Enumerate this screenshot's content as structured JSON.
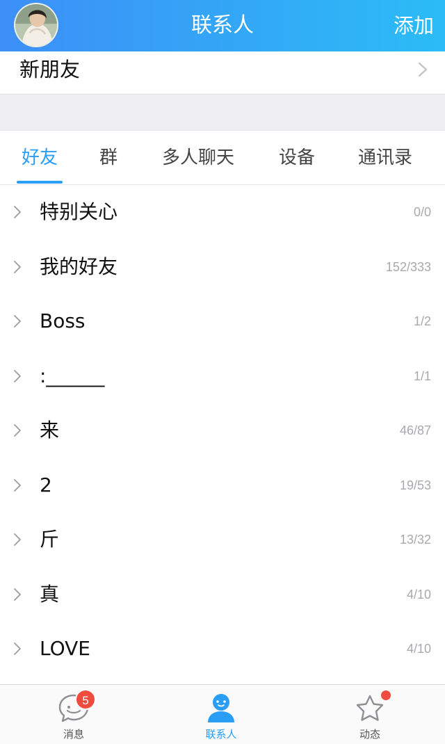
{
  "header": {
    "title": "联系人",
    "action_label": "添加",
    "avatar": "avatar-image",
    "colors": {
      "gradient_start": "#3d8ff7",
      "gradient_end": "#2bbcf6"
    }
  },
  "new_friends": {
    "label": "新朋友",
    "icon": "chevron-right-icon"
  },
  "tabs": [
    {
      "label": "好友",
      "active": true
    },
    {
      "label": "群",
      "active": false
    },
    {
      "label": "多人聊天",
      "active": false
    },
    {
      "label": "设备",
      "active": false
    },
    {
      "label": "通讯录",
      "active": false
    }
  ],
  "groups": [
    {
      "name": "特别关心",
      "count": "0/0"
    },
    {
      "name": "我的好友",
      "count": "152/333"
    },
    {
      "name": "Boss",
      "count": "1/2"
    },
    {
      "name": ":______",
      "count": "1/1"
    },
    {
      "name": "来",
      "count": "46/87"
    },
    {
      "name": "2",
      "count": "19/53"
    },
    {
      "name": "斤",
      "count": "13/32"
    },
    {
      "name": "真",
      "count": "4/10"
    },
    {
      "name": "LOVE",
      "count": "4/10"
    }
  ],
  "tabbar": {
    "messages": {
      "label": "消息",
      "icon": "chat-bubble-icon",
      "badge": "5"
    },
    "contacts": {
      "label": "联系人",
      "icon": "person-icon",
      "active": true
    },
    "moments": {
      "label": "动态",
      "icon": "star-icon",
      "has_dot": true
    }
  },
  "accent_color": "#2a9df4",
  "badge_color": "#ef4c3f"
}
